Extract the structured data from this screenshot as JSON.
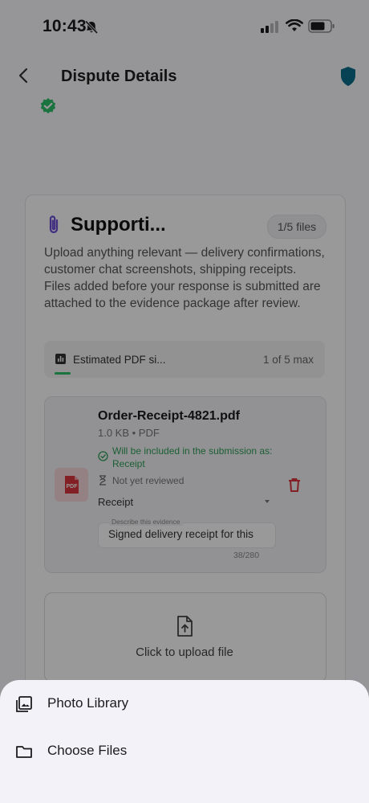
{
  "status_bar": {
    "time": "10:43"
  },
  "nav": {
    "title": "Dispute Details"
  },
  "evidence_card": {
    "title": "Supporti...",
    "file_count": "1/5 files",
    "description": "Upload anything relevant — delivery confirmations, customer chat screenshots, shipping receipts. Files added before your response is submitted are attached to the evidence package after review.",
    "estimate": {
      "label": "Estimated PDF si...",
      "right": "1 of 5 max",
      "progress": 0.2
    },
    "file": {
      "badge": "PDF",
      "name": "Order-Receipt-4821.pdf",
      "meta": "1.0 KB • PDF",
      "included_text": "Will be included in the submission as: Receipt",
      "review_status": "Not yet reviewed",
      "category": "Receipt",
      "description_label": "Describe this evidence",
      "description_value": "Signed delivery receipt for this",
      "char_count": "38/280"
    },
    "upload": {
      "label": "Click to upload file"
    }
  },
  "sheet": {
    "items": [
      {
        "label": "Photo Library",
        "icon": "photo-library-icon"
      },
      {
        "label": "Choose Files",
        "icon": "folder-icon"
      }
    ]
  },
  "colors": {
    "accent_green": "#2ec06a",
    "shield_blue": "#0a6e8c",
    "danger_red": "#d9363e",
    "clip_purple": "#6b4fd8"
  }
}
